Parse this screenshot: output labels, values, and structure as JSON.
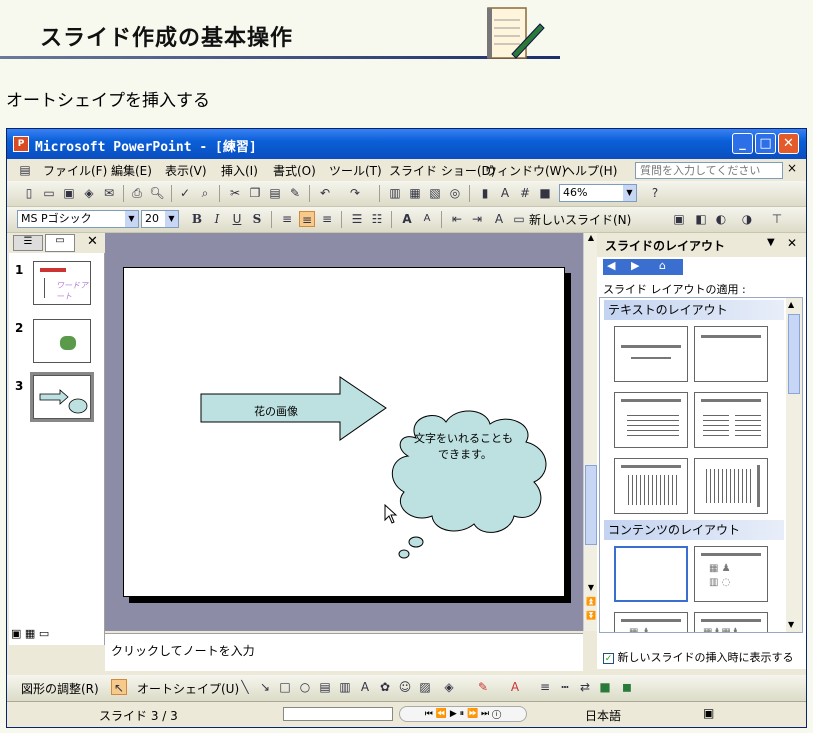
{
  "header": {
    "title": "スライド作成の基本操作"
  },
  "subtitle": "オートシェイプを挿入する",
  "window": {
    "title": "Microsoft PowerPoint - [練習]"
  },
  "menu": [
    "ファイル(F)",
    "編集(E)",
    "表示(V)",
    "挿入(I)",
    "書式(O)",
    "ツール(T)",
    "スライド ショー(D)",
    "ウィンドウ(W)",
    "ヘルプ(H)"
  ],
  "ask_placeholder": "質問を入力してください",
  "zoom": "46%",
  "font_name": "MS Pゴシック",
  "font_size": "20",
  "format_buttons": {
    "bold": "B",
    "italic": "I",
    "underline": "U",
    "shadow": "S"
  },
  "new_slide_label": "新しいスライド(N)",
  "thumbs": [
    "1",
    "2",
    "3"
  ],
  "thumb1_text": "ワードアート",
  "slide": {
    "arrow_text": "花の画像",
    "cloud_text_1": "文字をいれることも",
    "cloud_text_2": "できます。"
  },
  "taskpane": {
    "title": "スライドのレイアウト",
    "apply_label": "スライド レイアウトの適用 :",
    "section_text": "テキストのレイアウト",
    "section_content": "コンテンツのレイアウト",
    "show_checkbox": "新しいスライドの挿入時に表示する"
  },
  "notes_placeholder": "クリックしてノートを入力",
  "drawbar": {
    "adjust": "図形の調整(R)",
    "autoshape": "オートシェイプ(U)"
  },
  "status": {
    "slide": "スライド 3 / 3",
    "language": "日本語"
  }
}
